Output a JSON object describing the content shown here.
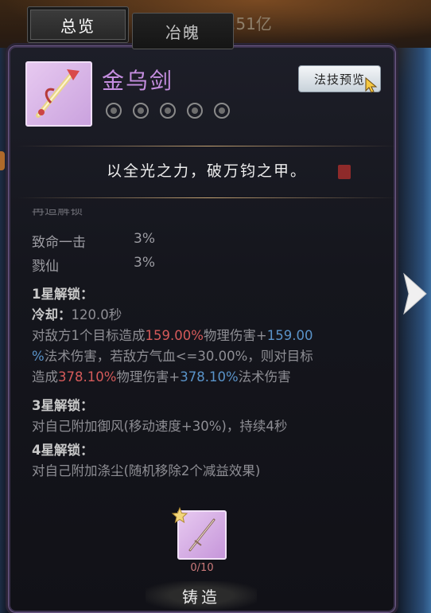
{
  "tabs": [
    {
      "label": "总览",
      "active": true
    },
    {
      "label": "冶魄",
      "active": false
    }
  ],
  "currency_text": ".51亿",
  "item": {
    "name": "金乌剑",
    "name_color": "#c58ee0",
    "icon": "golden-sword-icon",
    "star_slots": 5,
    "filled_stars": 0
  },
  "preview_button_label": "法技预览",
  "motto": "以全光之力，破万钧之甲。",
  "cut_heading": "再造解锁",
  "stats": [
    {
      "label": "致命一击",
      "value": "3%"
    },
    {
      "label": "戮仙",
      "value": "3%"
    }
  ],
  "unlock1": {
    "header": "1星解锁：",
    "cooldown_label": "冷却：",
    "cooldown_value": "120.0秒",
    "l1a": "对敌方1个目标造成",
    "l1b": "159.00%",
    "l1c": "物理伤害+",
    "l1d": "159.00",
    "l2a": "%",
    "l2b": "法术伤害，若敌方气血<=30.00%，则对目标",
    "l3a": "造成",
    "l3b": "378.10%",
    "l3c": "物理伤害+",
    "l3d": "378.10%",
    "l3e": "法术伤害"
  },
  "unlock3": {
    "header": "3星解锁：",
    "text": "对自己附加御风(移动速度+30%)，持续4秒"
  },
  "unlock4": {
    "header": "4星解锁：",
    "text": "对自己附加涤尘(随机移除2个减益效果)"
  },
  "forge": {
    "icon": "sword-material-icon",
    "count": "0/10",
    "button_label": "铸造"
  },
  "colors": {
    "damage_physical": "#d55a5a",
    "damage_magic": "#5a93c9",
    "panel_border": "#6d5a86"
  }
}
